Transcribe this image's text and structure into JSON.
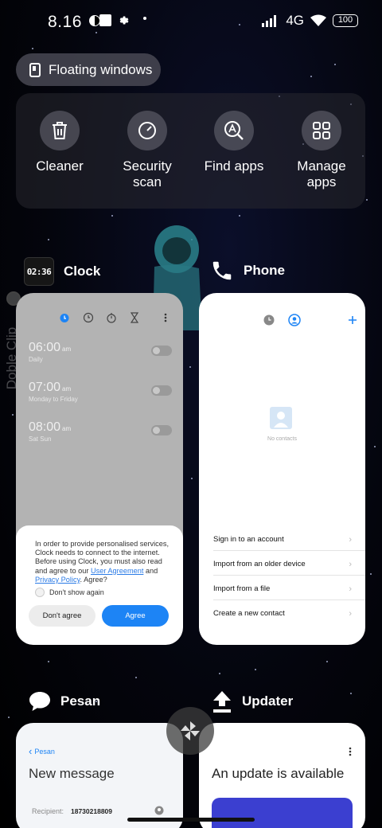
{
  "status_bar": {
    "time": "8.16",
    "network": "4G",
    "battery": "100",
    "icons": [
      "notification-badge-icon",
      "square-app-icon",
      "gear-icon",
      "more-dots-icon",
      "signal-icon",
      "wifi-icon",
      "battery-icon"
    ]
  },
  "floating_windows": {
    "label": "Floating windows",
    "icon": "floating-window-icon"
  },
  "tools": [
    {
      "label": "Cleaner",
      "icon": "trash-icon"
    },
    {
      "label": "Security scan",
      "icon": "security-scan-icon"
    },
    {
      "label": "Find apps",
      "icon": "find-apps-icon"
    },
    {
      "label": "Manage apps",
      "icon": "grid-apps-icon"
    }
  ],
  "side_label": "Doble Clip",
  "clock_app": {
    "name": "Clock",
    "badge": "02:36",
    "alarms": [
      {
        "time": "06:00",
        "ampm": "am",
        "repeat": "Daily"
      },
      {
        "time": "07:00",
        "ampm": "am",
        "repeat": "Monday to Friday"
      },
      {
        "time": "08:00",
        "ampm": "am",
        "repeat": "Sat Sun"
      }
    ],
    "consent": {
      "text_before": "In order to provide personalised services, Clock needs to connect to the internet. Before using Clock, you must also read and agree to our ",
      "link_user_agreement": "User Agreement",
      "text_and": " and ",
      "link_privacy": "Privacy Policy",
      "text_after": ". Agree?",
      "checkbox_label": "Don't show again",
      "disagree_label": "Don't agree",
      "agree_label": "Agree"
    }
  },
  "phone_app": {
    "name": "Phone",
    "empty_label": "No contacts",
    "menu": [
      "Sign in to an account",
      "Import from an older device",
      "Import from a file",
      "Create a new contact"
    ]
  },
  "pesan_app": {
    "name": "Pesan",
    "back_label": "Pesan",
    "title": "New message",
    "recipient_label": "Recipient:",
    "recipient_value": "18730218809"
  },
  "updater_app": {
    "name": "Updater",
    "title": "An update is available"
  },
  "colors": {
    "accent": "#1d84f5",
    "link": "#2b7be6"
  }
}
